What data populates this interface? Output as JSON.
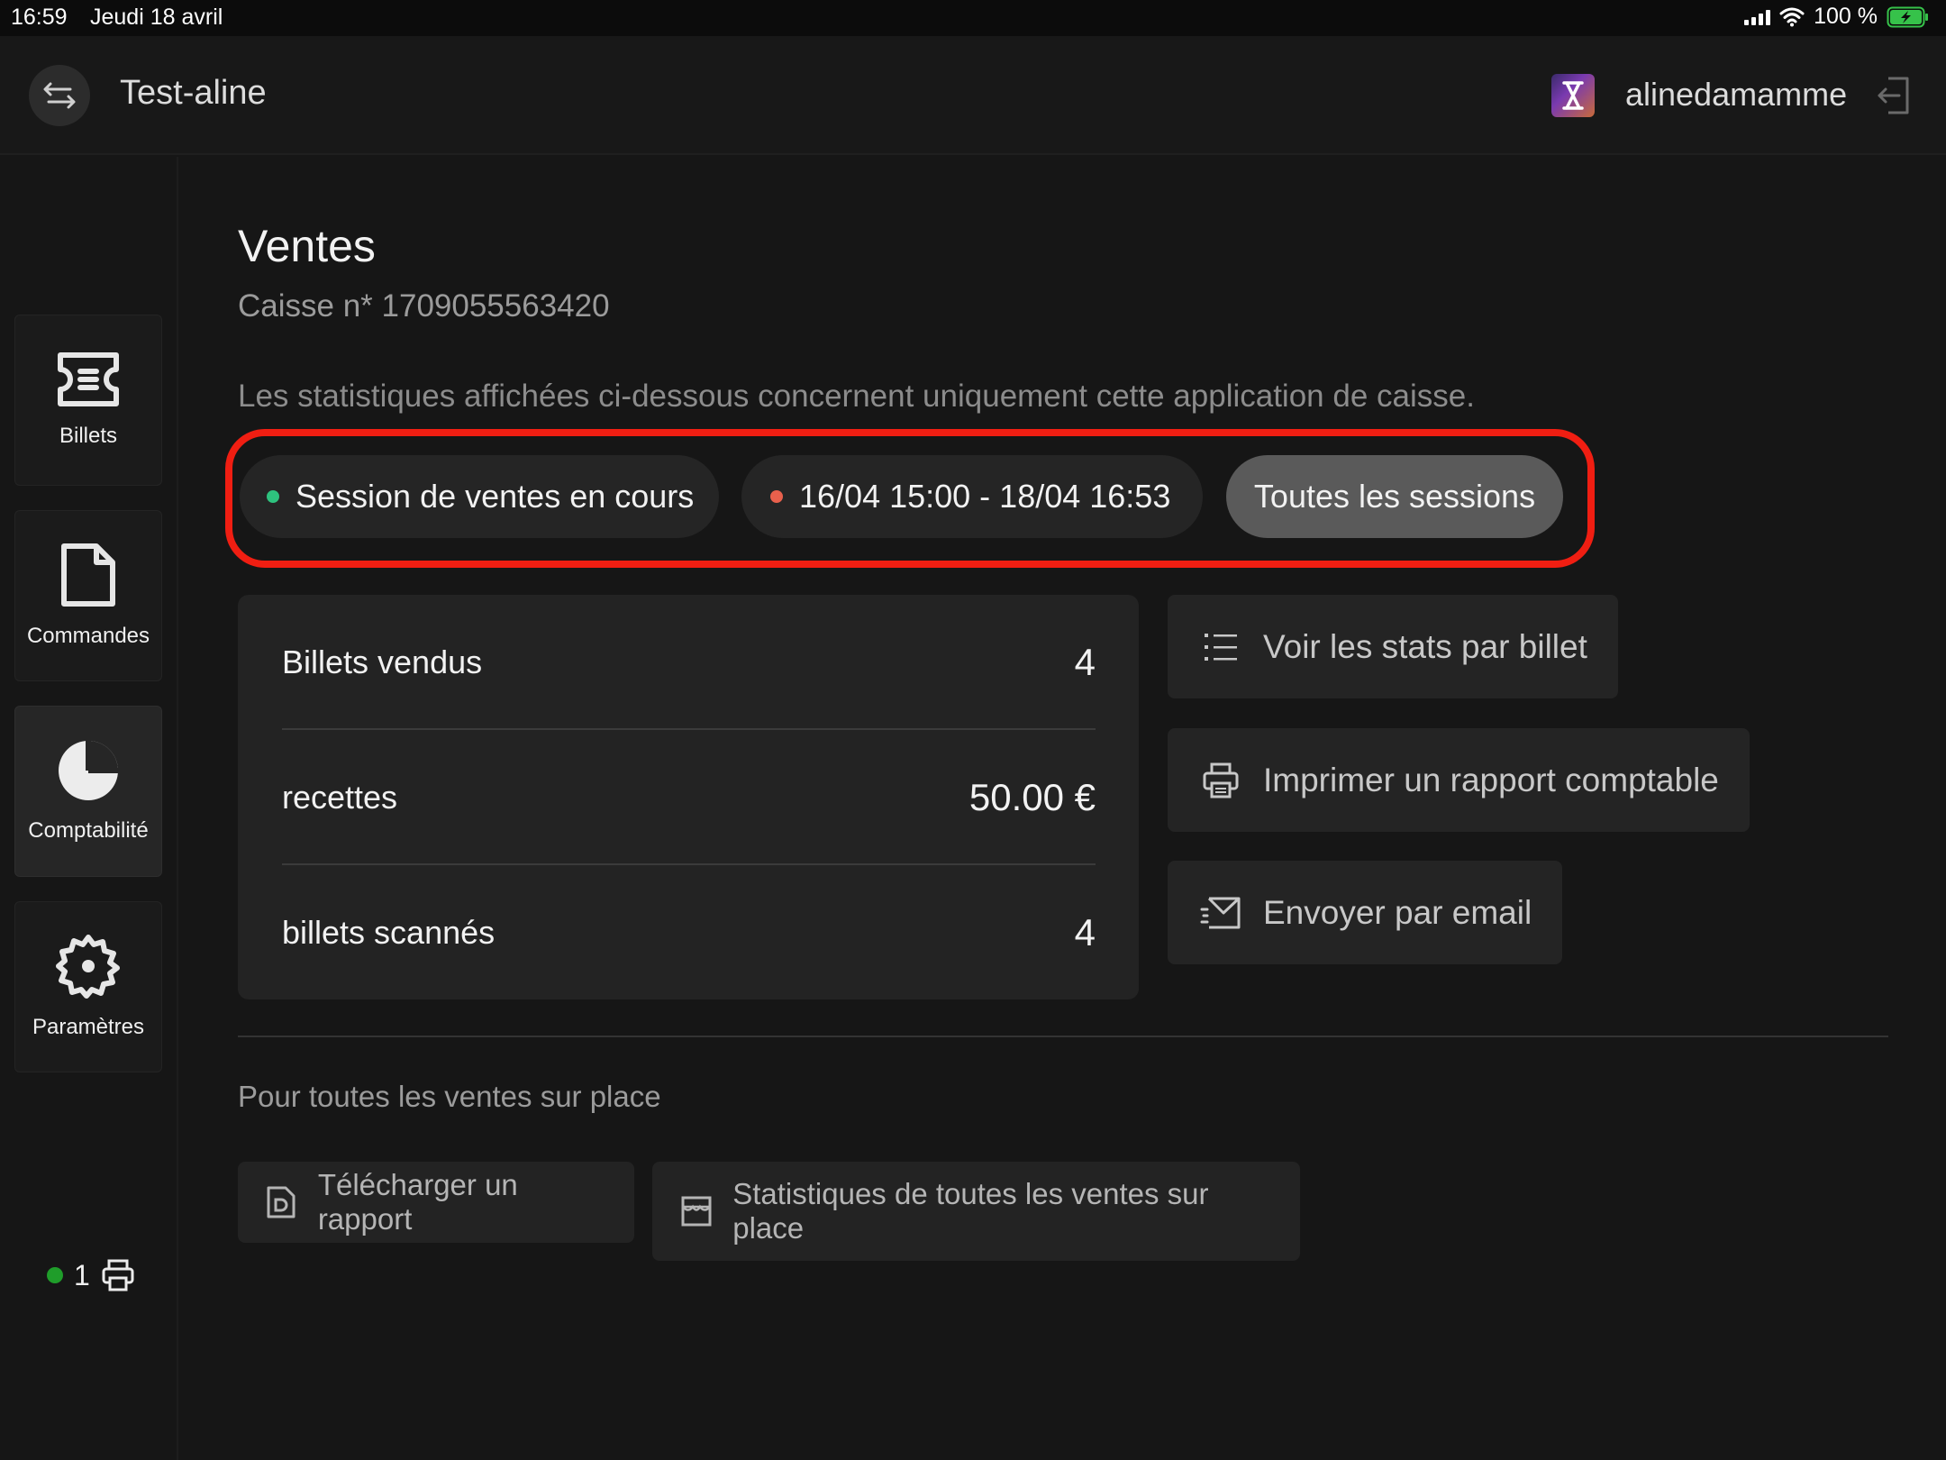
{
  "status_bar": {
    "time": "16:59",
    "date": "Jeudi 18 avril",
    "battery": "100 %"
  },
  "header": {
    "app_title": "Test-aline",
    "username": "alinedamamme"
  },
  "sidebar": {
    "items": [
      {
        "label": "Billets",
        "icon": "ticket-icon"
      },
      {
        "label": "Commandes",
        "icon": "document-icon"
      },
      {
        "label": "Comptabilité",
        "icon": "pie-chart-icon",
        "active": true
      },
      {
        "label": "Paramètres",
        "icon": "gear-icon"
      }
    ],
    "printer_count": "1"
  },
  "main": {
    "title": "Ventes",
    "subtitle": "Caisse n* 1709055563420",
    "description": "Les statistiques affichées ci-dessous concernent uniquement cette application de caisse.",
    "filters": [
      {
        "label": "Session de ventes en cours",
        "dot_color": "#2ec27e"
      },
      {
        "label": "16/04 15:00 - 18/04 16:53",
        "dot_color": "#e8604c"
      },
      {
        "label": "Toutes les sessions",
        "selected": true
      }
    ],
    "stats": [
      {
        "label": "Billets vendus",
        "value": "4"
      },
      {
        "label": "recettes",
        "value": "50.00 €"
      },
      {
        "label": "billets scannés",
        "value": "4"
      }
    ],
    "actions": {
      "stats_by_ticket": "Voir les stats par billet",
      "print_report": "Imprimer un rapport comptable",
      "send_email": "Envoyer par email"
    },
    "onsite_section": {
      "label": "Pour toutes les ventes sur place",
      "download_report": "Télécharger un rapport",
      "all_stats": "Statistiques de toutes les ventes sur place"
    }
  },
  "colors": {
    "highlight": "#f01e12",
    "background": "#161616",
    "card": "#232323"
  }
}
